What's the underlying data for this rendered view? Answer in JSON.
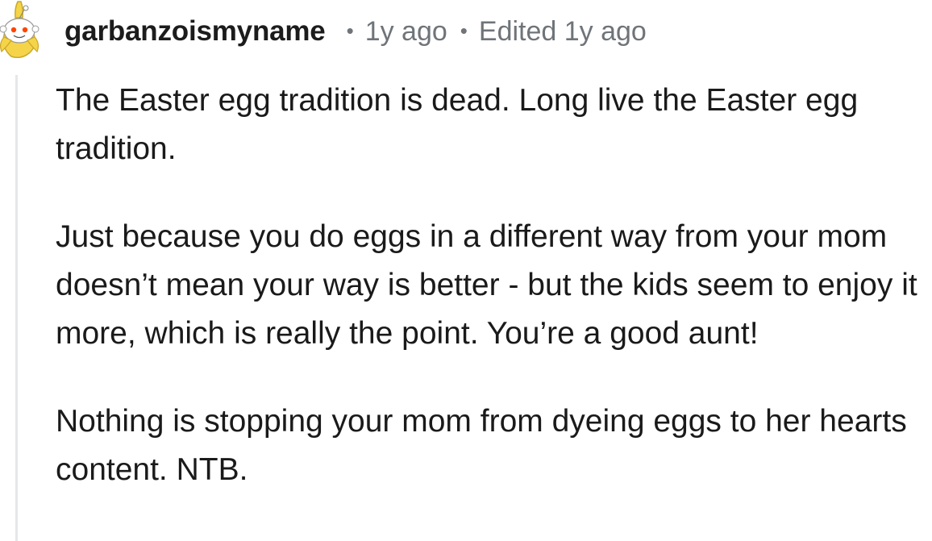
{
  "comment": {
    "username": "garbanzoismyname",
    "separator": "•",
    "posted": "1y ago",
    "edited": "Edited 1y ago",
    "paragraphs": [
      "The Easter egg tradition is dead. Long live the Easter egg tradition.",
      "Just because you do eggs in a different way from your mom doesn’t mean your way is better - but the kids seem to enjoy it more, which is really the point. You’re a good aunt!",
      "Nothing is stopping your mom from dyeing eggs to her hearts content. NTB."
    ]
  },
  "colors": {
    "username": "#1c1c1c",
    "meta": "#6f7479",
    "body_text": "#1a1a1b",
    "thread_line": "#e6e7e9",
    "avatar_banana": "#f5d44a"
  },
  "icons": {
    "avatar": "snoo-banana-avatar-icon"
  }
}
